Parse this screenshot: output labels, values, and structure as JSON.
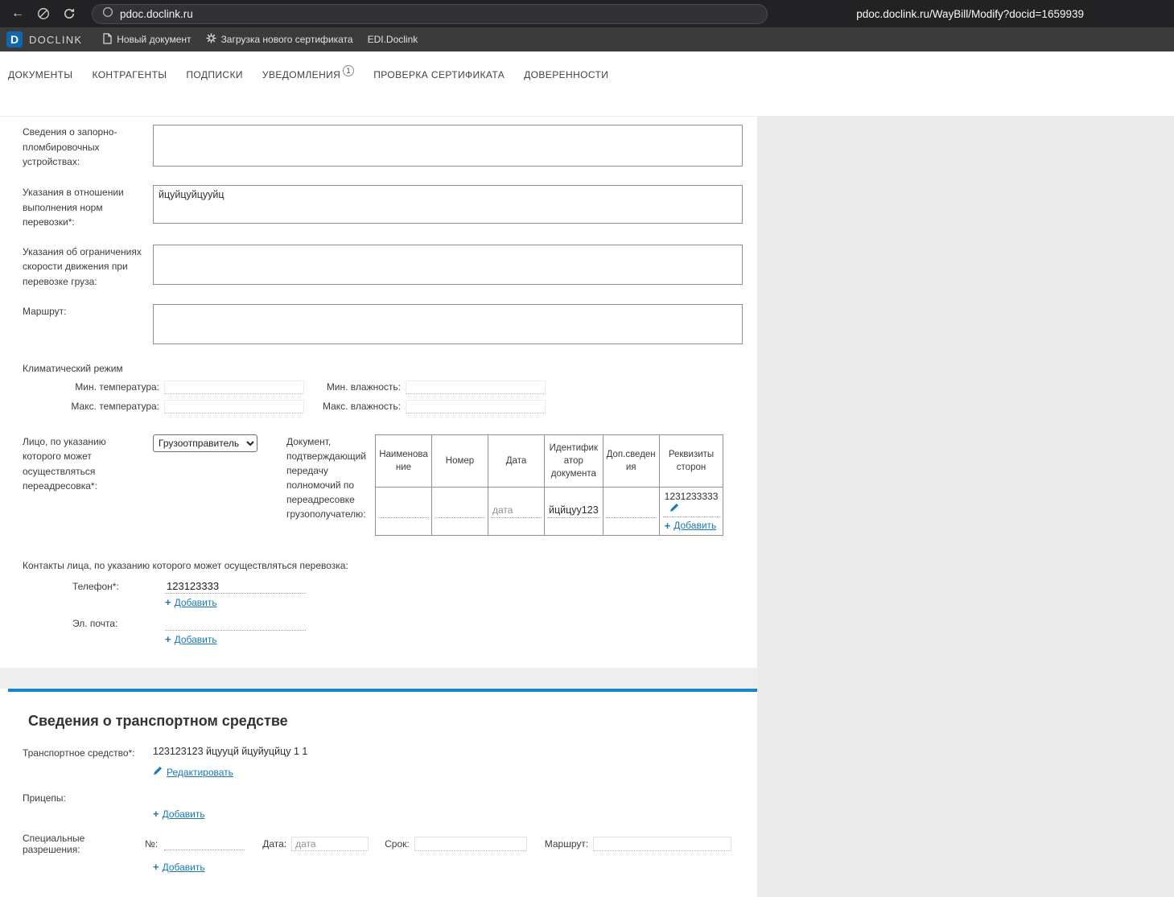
{
  "colors": {
    "accent_blue": "#1878b8",
    "divider_blue": "#1786c8",
    "logo_blue": "#1266ad"
  },
  "browser": {
    "url": "pdoc.doclink.ru",
    "status_url": "pdoc.doclink.ru/WayBill/Modify?docid=1659939"
  },
  "app_bar": {
    "logo_letter": "D",
    "brand": "DOCLINK",
    "menu": [
      {
        "label": "Новый документ"
      },
      {
        "label": "Загрузка нового сертификата"
      },
      {
        "label": "EDI.Doclink"
      }
    ]
  },
  "nav": {
    "items": [
      {
        "label": "ДОКУМЕНТЫ"
      },
      {
        "label": "КОНТРАГЕНТЫ"
      },
      {
        "label": "ПОДПИСКИ"
      },
      {
        "label": "УВЕДОМЛЕНИЯ",
        "badge": "1"
      },
      {
        "label": "ПРОВЕРКА СЕРТИФИКАТА"
      },
      {
        "label": "ДОВЕРЕННОСТИ"
      }
    ]
  },
  "form": {
    "sealing_label": "Сведения о запорно-пломбировочных устройствах:",
    "sealing_value": "",
    "norms_label": "Указания в отношении выполнения норм перевозки*:",
    "norms_value": "йцуйцуйцууйц",
    "speed_label": "Указания об ограничениях скорости движения при перевозке груза:",
    "speed_value": "",
    "route_label": "Маршрут:",
    "route_value": "",
    "climate_title": "Климатический режим",
    "min_temp_label": "Мин. температура:",
    "min_humidity_label": "Мин. влажность:",
    "max_temp_label": "Макс. температура:",
    "max_humidity_label": "Макс. влажность:",
    "redirect_label": "Лицо, по указанию которого может осуществляться переадресовка*:",
    "redirect_value": "Грузоотправитель",
    "transfer_doc_label": "Документ, подтверждающий передачу полномочий по переадресовке грузополучателю:",
    "doc_table": {
      "headers": [
        "Наименование",
        "Номер",
        "Дата",
        "Идентификатор документа",
        "Доп.сведения",
        "Реквизиты сторон"
      ],
      "date_placeholder": "дата",
      "identifier_value": "йцйцуу123",
      "requisites_value": "1231233333",
      "add_label": "Добавить"
    },
    "contacts_label": "Контакты лица, по указанию которого может осуществляться перевозка:",
    "phone_label": "Телефон*:",
    "phone_value": "123123333",
    "email_label": "Эл. почта:",
    "email_value": "",
    "add_label": "Добавить"
  },
  "vehicle": {
    "section_title": "Сведения о транспортном средстве",
    "vehicle_label": "Транспортное средство*:",
    "vehicle_value": "123123123 йцууцй йцуйуцйцу 1 1",
    "edit_label": "Редактировать",
    "trailers_label": "Прицепы:",
    "permits_label": "Специальные разрешения:",
    "number_label": "№:",
    "date_label": "Дата:",
    "date_placeholder": "дата",
    "term_label": "Срок:",
    "route_label": "Маршрут:",
    "add_label": "Добавить"
  }
}
